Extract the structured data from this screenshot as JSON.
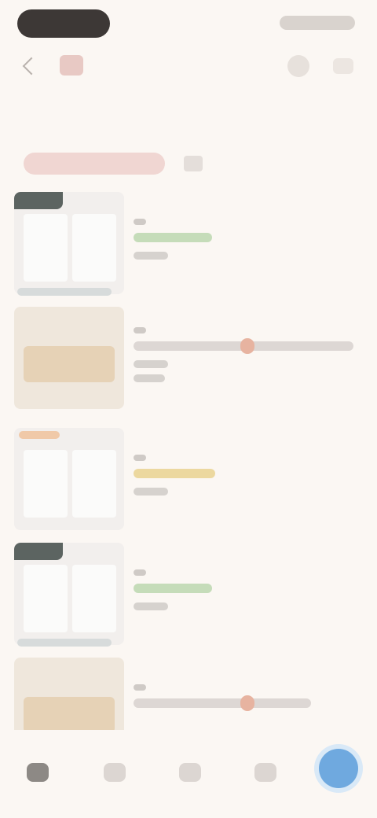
{
  "header": {
    "shop_name": "",
    "back_icon": "chevron-left-icon",
    "actions": [
      "share-icon",
      "more-icon"
    ]
  },
  "tabs": [
    "",
    "",
    "",
    "",
    ""
  ],
  "filter": {
    "chip_label": "",
    "sort_label": ""
  },
  "colors": {
    "background": "#fbf7f3",
    "accent_tab": "#e8a27a",
    "fab": "#6fa9df",
    "price_green": "#c5dcb9",
    "price_gold": "#ecd89f"
  },
  "bottom_nav": [
    "home-icon",
    "category-icon",
    "cart-icon",
    "message-icon",
    "profile-fab"
  ]
}
